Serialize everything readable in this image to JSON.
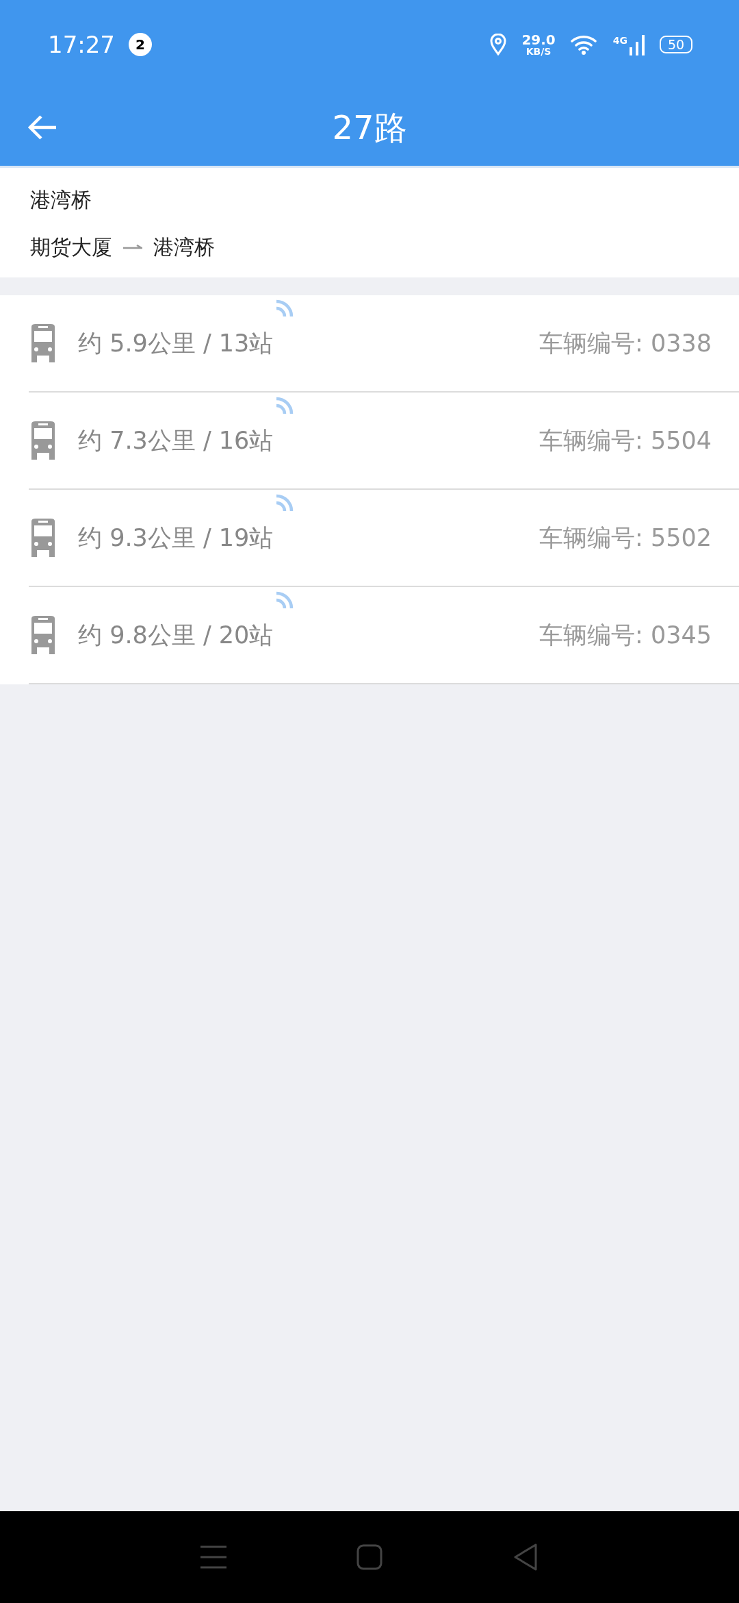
{
  "status_bar": {
    "time": "17:27",
    "notification_count": "2",
    "network_speed": "29.0",
    "speed_unit": "KB/S",
    "network_type": "4G",
    "battery": "50"
  },
  "header": {
    "title": "27路"
  },
  "route": {
    "stop": "港湾桥",
    "from": "期货大厦",
    "to": "港湾桥"
  },
  "buses": [
    {
      "distance": "约 5.9公里 / 13站",
      "vehicle": "车辆编号: 0338"
    },
    {
      "distance": "约 7.3公里 / 16站",
      "vehicle": "车辆编号: 5504"
    },
    {
      "distance": "约 9.3公里 / 19站",
      "vehicle": "车辆编号: 5502"
    },
    {
      "distance": "约 9.8公里 / 20站",
      "vehicle": "车辆编号: 0345"
    }
  ]
}
